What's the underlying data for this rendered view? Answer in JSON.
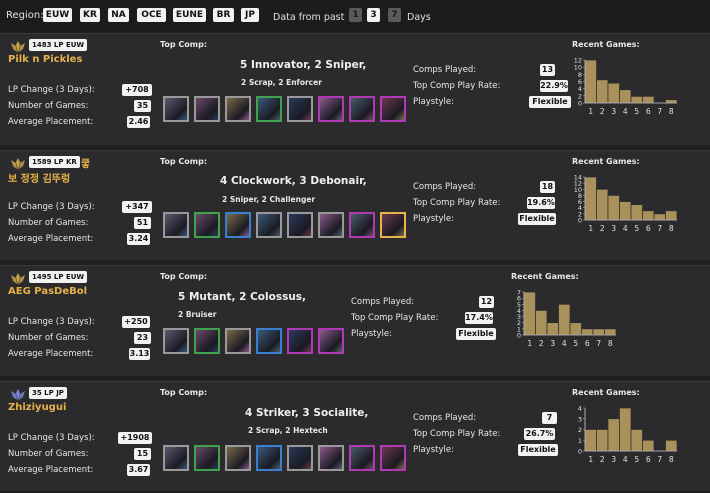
{
  "filter": {
    "region_label": "Region:",
    "regions": [
      "EUW",
      "KR",
      "NA",
      "OCE",
      "EUNE",
      "BR",
      "JP"
    ],
    "data_from_label": "Data from past",
    "day_options": [
      "1",
      "3",
      "7"
    ],
    "days_label": "Days"
  },
  "labels": {
    "top_comp": "Top Comp:",
    "recent_games": "Recent Games:",
    "lp_change": "LP Change (3 Days):",
    "number_of_games": "Number of Games:",
    "average_placement": "Average Placement:",
    "comps_played": "Comps Played:",
    "top_comp_play_rate": "Top Comp Play Rate:",
    "playstyle": "Playstyle:"
  },
  "players": [
    {
      "lp_badge": "1483 LP EUW",
      "name": "Pilk n Pickles",
      "lp_change": "+708",
      "games": "35",
      "avg_placement": "2.46",
      "comp_main": "5 Innovator, 2 Sniper,",
      "comp_sub": "2 Scrap, 2 Enforcer",
      "comps_played": "13",
      "play_rate": "22.9%",
      "playstyle": "Flexible",
      "champion_borders": [
        "#999999",
        "#999999",
        "#999999",
        "#3fa34d",
        "#999999",
        "#b03ab3",
        "#b03ab3",
        "#b03ab3"
      ],
      "chart_data": {
        "type": "bar",
        "categories": [
          "1",
          "2",
          "3",
          "4",
          "5",
          "6",
          "7",
          "8"
        ],
        "values": [
          13,
          7,
          6,
          4,
          2,
          2,
          0,
          1
        ],
        "yticks": [
          "12",
          "10",
          "8",
          "6",
          "4",
          "2",
          "0"
        ],
        "ylim": [
          0,
          13
        ]
      }
    },
    {
      "lp_badge": "1589 LP KR",
      "name": "보 정정 김뚜렁",
      "name_extra": "쿻",
      "lp_change": "+347",
      "games": "51",
      "avg_placement": "3.24",
      "comp_main": "4 Clockwork, 3 Debonair,",
      "comp_sub": "2 Sniper, 2 Challenger",
      "comps_played": "18",
      "play_rate": "19.6%",
      "playstyle": "Flexible",
      "champion_borders": [
        "#999999",
        "#3fa34d",
        "#3b7fd0",
        "#999999",
        "#999999",
        "#999999",
        "#b03ab3",
        "#e7b24a"
      ],
      "chart_data": {
        "type": "bar",
        "categories": [
          "1",
          "2",
          "3",
          "4",
          "5",
          "6",
          "7",
          "8"
        ],
        "values": [
          14,
          10,
          8,
          6,
          5,
          3,
          2,
          3
        ],
        "yticks": [
          "14",
          "12",
          "10",
          "8",
          "6",
          "4",
          "2",
          "0"
        ],
        "ylim": [
          0,
          14
        ]
      }
    },
    {
      "lp_badge": "1495 LP EUW",
      "name": "AEG PasDeBol",
      "lp_change": "+250",
      "games": "23",
      "avg_placement": "3.13",
      "comp_main": "5 Mutant, 2 Colossus,",
      "comp_sub": "2 Bruiser",
      "comps_played": "12",
      "play_rate": "17.4%",
      "playstyle": "Flexible",
      "champion_borders": [
        "#999999",
        "#3fa34d",
        "#999999",
        "#3b7fd0",
        "#b03ab3",
        "#b03ab3"
      ],
      "chart_data": {
        "type": "bar",
        "categories": [
          "1",
          "2",
          "3",
          "4",
          "5",
          "6",
          "7",
          "8"
        ],
        "values": [
          7,
          4,
          2,
          5,
          2,
          1,
          1,
          1
        ],
        "yticks": [
          "7",
          "6",
          "5",
          "4",
          "3",
          "2",
          "1",
          "0"
        ],
        "ylim": [
          0,
          7
        ]
      }
    },
    {
      "lp_badge": "35 LP JP",
      "name": "Zhiziyugui",
      "lp_change": "+1908",
      "games": "15",
      "avg_placement": "3.67",
      "comp_main": "4 Striker, 3 Socialite,",
      "comp_sub": "2 Scrap, 2 Hextech",
      "comps_played": "7",
      "play_rate": "26.7%",
      "playstyle": "Flexible",
      "champion_borders": [
        "#999999",
        "#3fa34d",
        "#999999",
        "#3b7fd0",
        "#999999",
        "#999999",
        "#b03ab3",
        "#b03ab3"
      ],
      "chart_data": {
        "type": "bar",
        "categories": [
          "1",
          "2",
          "3",
          "4",
          "5",
          "6",
          "7",
          "8"
        ],
        "values": [
          2,
          2,
          3,
          4,
          2,
          1,
          0,
          1
        ],
        "yticks": [
          "4",
          "3",
          "2",
          "1",
          "0"
        ],
        "ylim": [
          0,
          4
        ]
      }
    }
  ]
}
